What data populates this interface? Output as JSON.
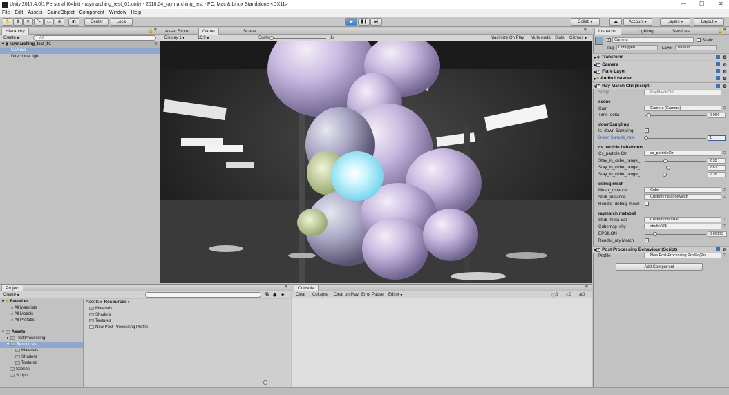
{
  "window": {
    "title": "Unity 2017.4.0f1 Personal (64bit) - raymarching_test_01.unity - 2018.04_raymarching_test - PC, Mac & Linux Standalone <DX11>"
  },
  "menu": [
    "File",
    "Edit",
    "Assets",
    "GameObject",
    "Component",
    "Window",
    "Help"
  ],
  "toolbar": {
    "center": "Center",
    "local": "Local",
    "collab": "Collab",
    "account": "Account",
    "layers": "Layers",
    "layout": "Layout"
  },
  "hierarchy": {
    "tab": "Hierarchy",
    "create": "Create",
    "search": "All",
    "scene": "raymarching_test_01",
    "items": [
      "Camera",
      "Directional light"
    ]
  },
  "center_tabs": [
    "Asset Store",
    "Game",
    "Scene"
  ],
  "game": {
    "display": "Display 1",
    "aspect": "16:9",
    "scale_label": "Scale",
    "scale_value": "1x",
    "options": [
      "Maximize On Play",
      "Mute Audio",
      "Stats",
      "Gizmos"
    ]
  },
  "inspector": {
    "tabs": [
      "Inspector",
      "Lighting",
      "Services"
    ],
    "object_name": "Camera",
    "static": "Static",
    "tag_label": "Tag",
    "tag": "Untagged",
    "layer_label": "Layer",
    "layer": "Default",
    "components": [
      "Transform",
      "Camera",
      "Flare Layer",
      "Audio Listener",
      "Ray March Ctrl (Script)"
    ],
    "script_label": "Script",
    "script_value": "RayMarchCtrl",
    "sections": {
      "scene": "scene",
      "cam_label": "Cam",
      "cam_value": "Camera (Camera)",
      "time_label": "Time_delta",
      "time_value": "0.064",
      "down": "downSampling",
      "is_down": "Is_down Sampling",
      "rate_label": "Down Sample_rate",
      "rate_value": "1",
      "cs": "cs particle behaviours",
      "csctrl_label": "Cs_particle Ctrl",
      "csctrl_value": "cs_particleCtrl",
      "stay1_label": "Stay_in_cube_range_",
      "stay1_value": "2.33",
      "stay2_label": "Stay_in_cube_range_",
      "stay2_value": "2.67",
      "stay3_label": "Stay_in_cube_range_",
      "stay3_value": "2.26",
      "debug": "debug mesh",
      "mesh_label": "Mesh_instance",
      "mesh_value": "Cube",
      "shdr_label": "Shdr_instance",
      "shdr_value": "Custom/InstanceMesh",
      "render_debug": "Render_debug_mesh",
      "ray": "raymarch metaball",
      "meta_label": "Shdr_meta Ball",
      "meta_value": "Custom/metaBall",
      "cube_label": "Cubemap_sky",
      "cube_value": "studio024",
      "eps_label": "EPSILON",
      "eps_value": "0.00173",
      "render_ray": "Render_ray March"
    },
    "post_comp": "Post Processing Behaviour (Script)",
    "profile_label": "Profile",
    "profile_value": "New Post-Processing Profile (Po",
    "add_component": "Add Component"
  },
  "project": {
    "tab": "Project",
    "create": "Create",
    "favorites": "Favorites",
    "fav_items": [
      "All Materials",
      "All Models",
      "All Prefabs"
    ],
    "assets": "Assets",
    "asset_items": [
      "PostProcessing",
      "Resources",
      "Materials",
      "Shaders",
      "Textures",
      "Scenes",
      "Scripts"
    ],
    "breadcrumb_root": "Assets",
    "breadcrumb_child": "Resources",
    "files": [
      "Materials",
      "Shaders",
      "Textures",
      "New Post-Processing Profile"
    ]
  },
  "console": {
    "tab": "Console",
    "buttons": [
      "Clear",
      "Collapse",
      "Clear on Play",
      "Error Pause",
      "Editor"
    ],
    "counts": [
      "0",
      "0",
      "0"
    ]
  }
}
